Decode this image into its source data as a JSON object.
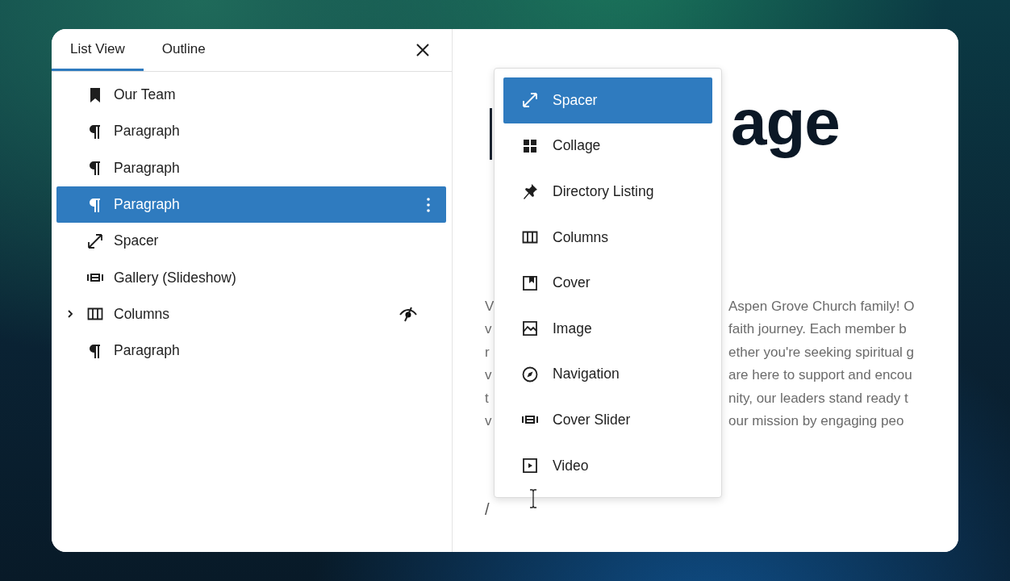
{
  "panel": {
    "tabs": [
      {
        "label": "List View",
        "selected": true
      },
      {
        "label": "Outline",
        "selected": false
      }
    ],
    "blocks": [
      {
        "label": "Our Team",
        "kind": "bookmark",
        "selected": false,
        "hidden": false
      },
      {
        "label": "Paragraph",
        "kind": "paragraph",
        "selected": false,
        "hidden": false
      },
      {
        "label": "Paragraph",
        "kind": "paragraph",
        "selected": false,
        "hidden": false
      },
      {
        "label": "Paragraph",
        "kind": "paragraph",
        "selected": true,
        "hidden": false
      },
      {
        "label": "Spacer",
        "kind": "spacer",
        "selected": false,
        "hidden": false
      },
      {
        "label": "Gallery (Slideshow)",
        "kind": "slideshow",
        "selected": false,
        "hidden": false
      },
      {
        "label": "Columns",
        "kind": "columns",
        "selected": false,
        "hidden": true,
        "expanded": false
      },
      {
        "label": "Paragraph",
        "kind": "paragraph",
        "selected": false,
        "hidden": false
      }
    ]
  },
  "inserter": {
    "items": [
      {
        "label": "Spacer",
        "kind": "spacer",
        "selected": true
      },
      {
        "label": "Collage",
        "kind": "grid",
        "selected": false
      },
      {
        "label": "Directory Listing",
        "kind": "pin",
        "selected": false
      },
      {
        "label": "Columns",
        "kind": "columns",
        "selected": false
      },
      {
        "label": "Cover",
        "kind": "cover",
        "selected": false
      },
      {
        "label": "Image",
        "kind": "image",
        "selected": false
      },
      {
        "label": "Navigation",
        "kind": "compass",
        "selected": false
      },
      {
        "label": "Cover Slider",
        "kind": "slideshow",
        "selected": false
      },
      {
        "label": "Video",
        "kind": "video",
        "selected": false
      }
    ]
  },
  "editor": {
    "heading": "age",
    "paragraph_left": [
      "V",
      "v",
      "r",
      "v",
      "t",
      "v"
    ],
    "paragraph_right": [
      "Aspen Grove Church family! O",
      "faith journey. Each member b",
      "ether you're seeking spiritual g",
      "are here to support and encou",
      "nity, our leaders stand ready t",
      "our mission by engaging peo"
    ],
    "slash": "/"
  }
}
